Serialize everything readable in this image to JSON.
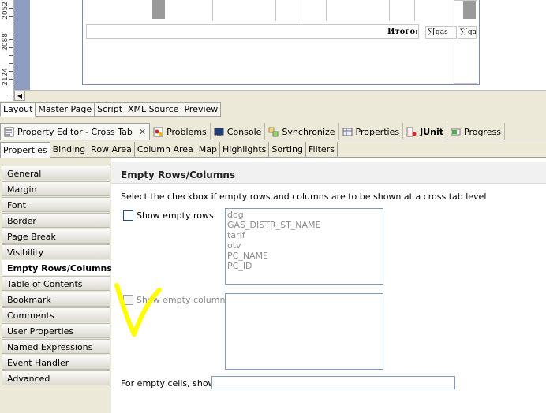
{
  "ruler": {
    "marks": [
      "2052",
      "2088",
      "2124"
    ]
  },
  "report": {
    "footer_label": "Итого:",
    "cells": [
      "∑[gas",
      "∑[ga"
    ]
  },
  "editor_tabs": [
    {
      "label": "Layout",
      "active": true
    },
    {
      "label": "Master Page",
      "active": false
    },
    {
      "label": "Script",
      "active": false
    },
    {
      "label": "XML Source",
      "active": false
    },
    {
      "label": "Preview",
      "active": false
    }
  ],
  "view_tabs": {
    "property_editor": "Property Editor - Cross Tab",
    "problems": "Problems",
    "console": "Console",
    "synchronize": "Synchronize",
    "properties": "Properties",
    "junit": "JUnit",
    "progress": "Progress"
  },
  "prop_tabs": [
    "Properties",
    "Binding",
    "Row Area",
    "Column Area",
    "Map",
    "Highlights",
    "Sorting",
    "Filters"
  ],
  "categories": [
    "General",
    "Margin",
    "Font",
    "Border",
    "Page Break",
    "Visibility",
    "Empty Rows/Columns",
    "Table of Contents",
    "Bookmark",
    "Comments",
    "User Properties",
    "Named Expressions",
    "Event Handler",
    "Advanced"
  ],
  "active_category": "Empty Rows/Columns",
  "section": {
    "title": "Empty Rows/Columns",
    "description": "Select the checkbox if empty rows and columns are to be shown at a cross tab level",
    "show_rows_label": "Show empty rows",
    "show_rows_checked": false,
    "rows_list": [
      "dog",
      "GAS_DISTR_ST_NAME",
      "tarif",
      "otv",
      "PC_NAME",
      "PC_ID"
    ],
    "show_columns_label": "Show empty columns",
    "show_columns_checked": false,
    "columns_list": [],
    "empty_cells_label": "For empty cells, show:",
    "empty_cells_value": ""
  },
  "colors": {
    "annotation": "#ffff00",
    "canvas_bg": "#8e9dc0",
    "panel_bg": "#ece9d8"
  }
}
